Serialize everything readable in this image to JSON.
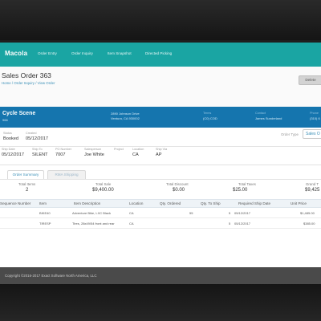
{
  "nav": {
    "brand": "Macola",
    "items": [
      "Order Entry",
      "Order Inquiry",
      "Item Snapshot",
      "Directed Picking"
    ]
  },
  "page": {
    "title": "Sales Order 363",
    "breadcrumb": "Home / Order Inquiry / View Order",
    "delete_label": "Delete"
  },
  "customer": {
    "name": "Cycle Scene",
    "id": "966",
    "address_line1": "2890 Johnson Drive",
    "address_line2": "Ventura, CA 930002",
    "terms_label": "Terms",
    "terms": "(C0) COD",
    "contact_label": "Contact",
    "contact": "James Sunderland",
    "phone_label": "Phone",
    "phone": "(310) 6"
  },
  "status": {
    "status_label": "Status",
    "status": "Booked",
    "created_label": "Created",
    "created": "05/12/2017",
    "order_type_label": "Order Type",
    "order_type": "Sales O"
  },
  "shipping": {
    "ship_date_label": "Ship Date",
    "ship_date": "05/12/2017",
    "ship_to_label": "Ship To",
    "ship_to": "SILENT",
    "po_label": "PO Number",
    "po": "7007",
    "salesperson_label": "Salesperson",
    "salesperson": "Joe White",
    "project_label": "Project",
    "project": "",
    "location_label": "Location",
    "location": "CA",
    "ship_via_label": "Ship Via",
    "ship_via": "AP"
  },
  "tabs": [
    "Order Summary",
    "RMA Shipping"
  ],
  "totals": {
    "total_items_label": "Total Items",
    "total_items": "2",
    "total_sale_label": "Total Sale",
    "total_sale": "$9,400.00",
    "total_discount_label": "Total Discount",
    "total_discount": "$0.00",
    "total_taxes_label": "Total Taxes",
    "total_taxes": "$25.00",
    "grand_total_label": "Grand T",
    "grand_total": "$9,425"
  },
  "grid": {
    "columns": [
      "Sequence Number",
      "Item",
      "Item Description",
      "Location",
      "Qty. Ordered",
      "Qty. To Ship",
      "Required Ship Date",
      "Unit Price"
    ],
    "rows": [
      {
        "seq": "",
        "item": "BIKE40",
        "desc": "Adventure Bike, LXC Black",
        "location": "CA",
        "qty_ordered": "55",
        "qty_to_ship": "5",
        "ship_date": "05/12/2017",
        "price": "$1,485.00"
      },
      {
        "seq": "",
        "item": "TIRESP",
        "desc": "Tires, 28x49/54 front and rear",
        "location": "CA",
        "qty_ordered": "",
        "qty_to_ship": "5",
        "ship_date": "05/12/2017",
        "price": "$385.00"
      }
    ]
  },
  "footer": {
    "text": "Copyright ©2016-2017 Exact Software North America, LLC"
  }
}
